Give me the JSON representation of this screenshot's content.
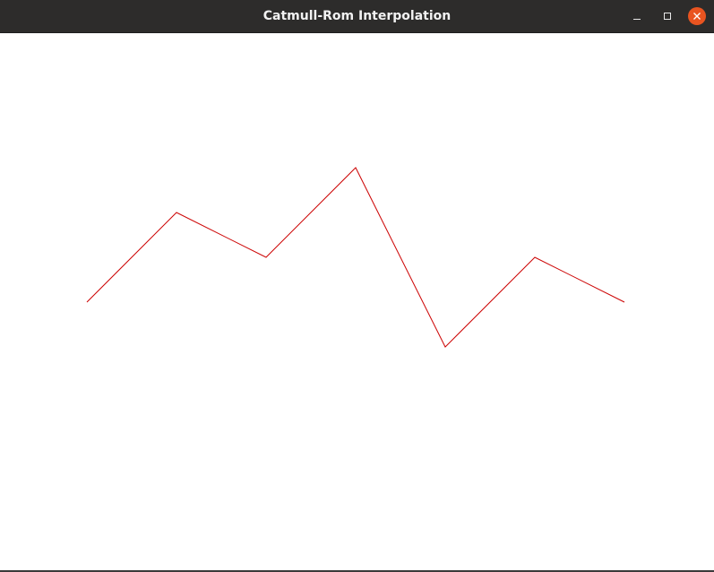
{
  "window": {
    "title": "Catmull-Rom Interpolation"
  },
  "titlebar_buttons": {
    "minimize": "minimize-icon",
    "maximize": "maximize-icon",
    "close": "close-icon"
  },
  "colors": {
    "titlebar": "#2d2c2b",
    "title_text": "#f2f2f2",
    "close_button": "#e95420",
    "canvas_background": "#ffffff",
    "curve": "#cc0000"
  }
}
